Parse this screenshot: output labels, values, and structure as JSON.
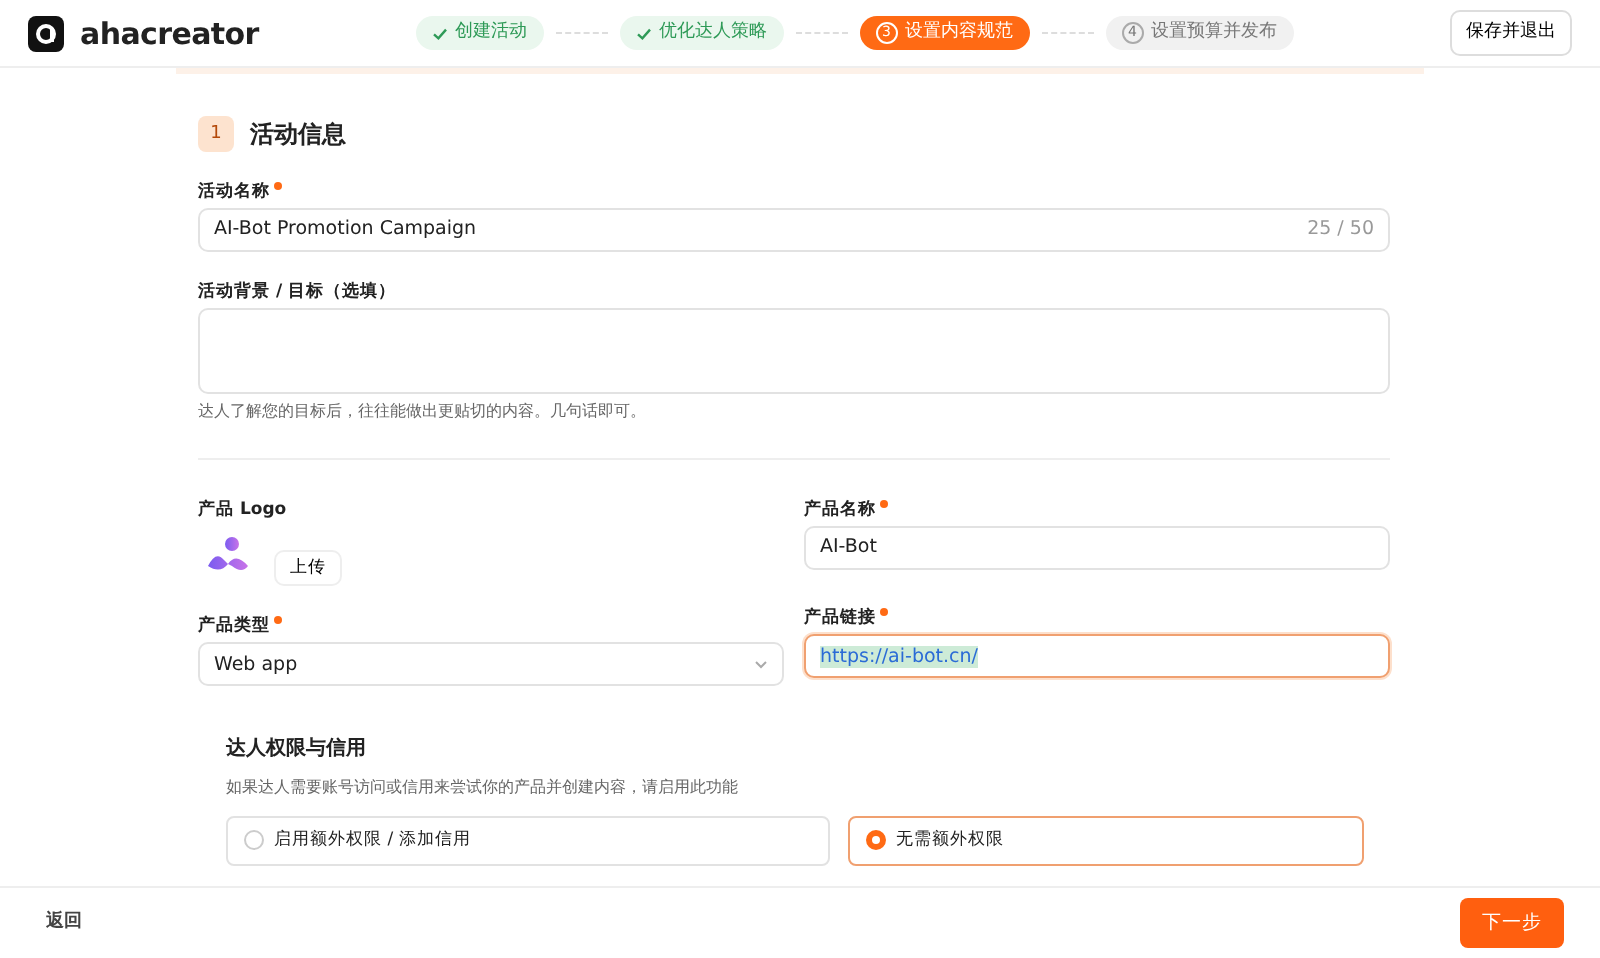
{
  "header": {
    "logo_text": "ahacreator",
    "steps": [
      {
        "label": "创建活动",
        "completed": true,
        "selected": false
      },
      {
        "label": "优化达人策略",
        "completed": true,
        "selected": false
      },
      {
        "label": "设置内容规范",
        "completed": false,
        "selected": true,
        "number": "3"
      },
      {
        "label": "设置预算并发布",
        "completed": false,
        "selected": false,
        "number": "4"
      }
    ],
    "save_button": "保存并退出"
  },
  "section": {
    "number": "1",
    "title": "活动信息"
  },
  "campaign_name": {
    "label": "活动名称",
    "required": true,
    "value": "AI-Bot Promotion Campaign",
    "counter": "25 / 50"
  },
  "background": {
    "label": "活动背景 / 目标（选填）",
    "hint": "达人了解您的目标后，往往能做出更贴切的内容。几句话即可。"
  },
  "logo": {
    "label": "产品 Logo",
    "upload_button": "上传"
  },
  "product_name": {
    "label": "产品名称",
    "required": true,
    "value": "AI-Bot"
  },
  "product_type": {
    "label": "产品类型",
    "required": true,
    "value": "Web app"
  },
  "product_link": {
    "label": "产品链接",
    "required": true,
    "value": "https://ai-bot.cn/",
    "focused": true
  },
  "permissions": {
    "title": "达人权限与信用",
    "description": "如果达人需要账号访问或信用来尝试你的产品并创建内容，请启用此功能",
    "options": [
      {
        "label": "启用额外权限 / 添加信用",
        "selected": false
      },
      {
        "label": "无需额外权限",
        "selected": true
      }
    ]
  },
  "footer": {
    "back": "返回",
    "next": "下一步"
  }
}
